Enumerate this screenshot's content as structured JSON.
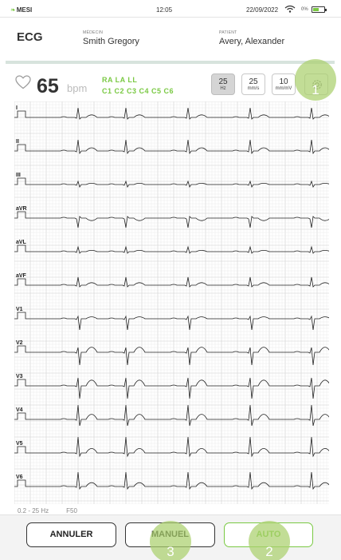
{
  "status_bar": {
    "logo": "MESI",
    "time": "12:05",
    "date": "22/09/2022",
    "battery": "0%",
    "battery_level": 0.55,
    "icons": [
      "leaf-logo-icon",
      "wifi-icon",
      "battery-icon"
    ]
  },
  "header": {
    "title": "ECG",
    "doctor_label": "MÉDECIN",
    "doctor_value": "Smith Gregory",
    "patient_label": "PATIENT",
    "patient_value": "Avery, Alexander"
  },
  "ecg": {
    "heart_rate": "65",
    "heart_rate_unit": "bpm",
    "leads_row1": "RA  LA  LL",
    "leads_row2": "C1  C2  C3  C4  C5  C6",
    "settings": [
      {
        "value": "25",
        "unit": "Hz"
      },
      {
        "value": "25",
        "unit": "mm/s"
      },
      {
        "value": "10",
        "unit": "mm/mV"
      }
    ],
    "lead_labels": [
      "I",
      "II",
      "III",
      "aVR",
      "aVL",
      "aVF",
      "V1",
      "V2",
      "V3",
      "V4",
      "V5",
      "V6"
    ],
    "filter_range": "0.2 - 25 Hz",
    "filter_code": "F50",
    "accent_color": "#7ac943"
  },
  "buttons": {
    "cancel": "ANNULER",
    "manual": "MANUEL",
    "auto": "AUTO"
  },
  "callouts": [
    "1",
    "2",
    "3"
  ]
}
